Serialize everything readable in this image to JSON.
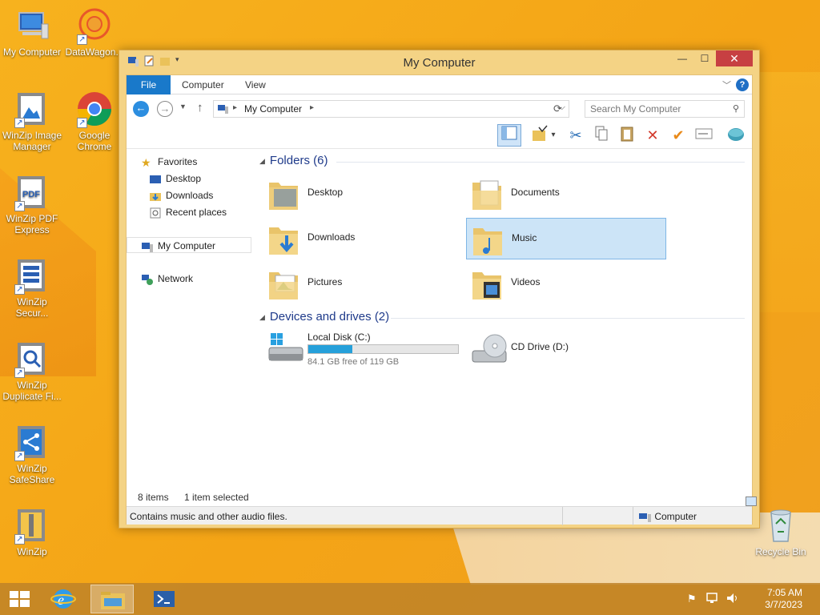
{
  "desktop": {
    "icons": [
      {
        "label": "My Computer"
      },
      {
        "label": "DataWagon..."
      },
      {
        "label": "WinZip Image Manager"
      },
      {
        "label": "Google Chrome"
      },
      {
        "label": "WinZip PDF Express"
      },
      {
        "label": "WinZip Secur..."
      },
      {
        "label": "WinZip Duplicate Fi..."
      },
      {
        "label": "WinZip SafeShare"
      },
      {
        "label": "WinZip"
      },
      {
        "label": "Recycle Bin"
      }
    ]
  },
  "window": {
    "title": "My Computer",
    "ribbon": {
      "tabs": [
        "File",
        "Computer",
        "View"
      ],
      "help": "?"
    },
    "address": {
      "crumb": "My Computer",
      "search_placeholder": "Search My Computer"
    },
    "nav": {
      "favorites": "Favorites",
      "desktop": "Desktop",
      "downloads": "Downloads",
      "recent": "Recent places",
      "my_computer": "My Computer",
      "network": "Network"
    },
    "content": {
      "folders_header": "Folders (6)",
      "folders": [
        {
          "name": "Desktop"
        },
        {
          "name": "Documents"
        },
        {
          "name": "Downloads"
        },
        {
          "name": "Music"
        },
        {
          "name": "Pictures"
        },
        {
          "name": "Videos"
        }
      ],
      "devices_header": "Devices and drives (2)",
      "drives": [
        {
          "name": "Local Disk (C:)",
          "free_text": "84.1 GB free of 119 GB",
          "used_fraction": 0.293
        },
        {
          "name": "CD Drive (D:)"
        }
      ]
    },
    "status": {
      "items": "8 items",
      "selected": "1 item selected",
      "info": "Contains music and other audio files.",
      "location": "Computer"
    }
  },
  "taskbar": {
    "time": "7:05 AM",
    "date": "3/7/2023"
  },
  "colors": {
    "accent": "#1979ca",
    "selection": "#cce4f7",
    "close": "#c74042",
    "drive_fill": "#26a0da"
  }
}
